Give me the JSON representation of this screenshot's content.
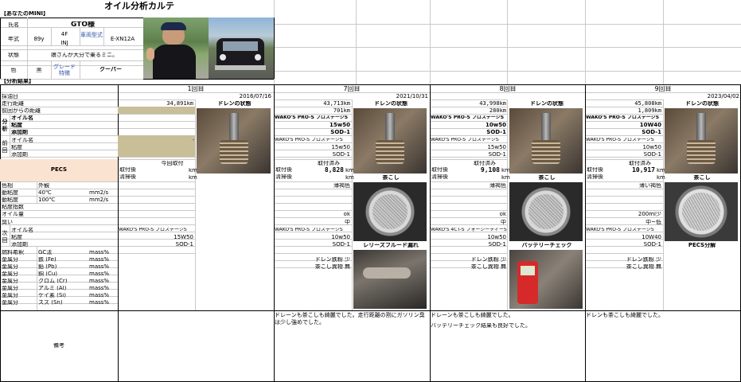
{
  "title": "オイル分析カルテ",
  "profile": {
    "section": "【あなたのMINI】",
    "name_label": "氏名",
    "name_value": "GTO様",
    "year_label": "年式",
    "year_value": "89y",
    "engine_top": "4F",
    "engine_bottom": "INJ",
    "vehicle_type_label": "車両型式",
    "vehicle_type_value": "E-XN12A",
    "condition_label": "状態",
    "condition_value": "娘さんが大分で乗るミニ。",
    "color_label": "色",
    "color_value": "黒",
    "grade_label": "グレード特徴",
    "grade_value": "クーパー"
  },
  "results_section": "【分析結果】",
  "rows": {
    "date": "採油日",
    "mileage": "走行距離",
    "since_change": "前回からの距離",
    "oil_name": "オイル名",
    "viscosity": "粘度",
    "additive": "添加剤",
    "side_bunseki": "分析",
    "side_zenkai": "前回",
    "side_jikai": "次回",
    "pecs": "PECS",
    "color_appearance_a": "色相",
    "color_appearance_b": "外観",
    "kin40_a": "動粘度",
    "kin40_b": "40℃",
    "kin40_unit": "mm2/s",
    "kin100_a": "動粘度",
    "kin100_b": "100℃",
    "kin100_unit": "mm2/s",
    "vi": "粘度指数",
    "oil_amount": "オイル量",
    "smell": "臭い",
    "fuel_dilution_a": "燃料希釈",
    "fuel_dilution_b": "GC法",
    "unit": "mass%",
    "metals": [
      {
        "a": "金属分",
        "b": "鉄 (Fe)"
      },
      {
        "a": "金属分",
        "b": "鉛 (Pb)"
      },
      {
        "a": "金属分",
        "b": "銅 (Cu)"
      },
      {
        "a": "金属分",
        "b": "クロム (Cr)"
      },
      {
        "a": "金属分",
        "b": "アルミ (Al)"
      },
      {
        "a": "金属分",
        "b": "ケイ素 (Si)"
      },
      {
        "a": "金属分",
        "b": "スズ (Sn)"
      }
    ],
    "remarks": "備考"
  },
  "visits": [
    {
      "header": "1回目",
      "date": "2016/07/16",
      "mileage": "34,891km",
      "since": "",
      "oil": "",
      "visc": "",
      "add": "",
      "prev_oil": "-",
      "prev_visc": "",
      "prev_add": "",
      "pecs_title": "今回取付",
      "pecs_install": "取付後",
      "pecs_clean": "清掃後",
      "pecs_install_value": "",
      "pecs_km": "km",
      "color": "",
      "smell": "",
      "next_oil": "WAKO'S PRO-S プロステージS",
      "next_visc": "15W50",
      "next_add": "SOD-1",
      "drain_title": "ドレンの状態",
      "photo2_title": "",
      "crud1": "",
      "crud2": "",
      "remark": ""
    },
    {
      "header": "7回目",
      "date": "2021/10/31",
      "mileage": "43,713km",
      "since": "701km",
      "oil": "WAKO'S PRO-S プロステージS",
      "visc": "15w50",
      "add": "SOD-1",
      "prev_oil": "WAKO'S PRO-S プロステージS",
      "prev_visc": "15w50",
      "prev_add": "SOD-1",
      "pecs_title": "取付済み",
      "pecs_install": "取付後",
      "pecs_clean": "清掃後",
      "pecs_install_value": "8,828",
      "pecs_km": "km",
      "color": "薄褐色",
      "amount": "ok",
      "smell": "中",
      "next_oil": "WAKO'S PRO-S プロステージS",
      "next_visc": "10w50",
      "next_add": "SOD-1",
      "drain_title": "ドレンの状態",
      "strainer_title": "茶こし",
      "photo2_title": "レリーズフルード漏れ",
      "crud1": "ドレン鉄粉 少",
      "crud2": "茶こし異物 無",
      "remark": "ドレーンも茶こしも綺麗でした。走行距離の割にガソリン臭は少し強めでした。"
    },
    {
      "header": "8回目",
      "date": "",
      "mileage": "43,998km",
      "since": "280km",
      "oil": "WAKO'S PRO-S プロステージS",
      "visc": "10w50",
      "add": "SOD-1",
      "prev_oil": "WAKO'S PRO-S プロステージS",
      "prev_visc": "15w50",
      "prev_add": "SOD-1",
      "pecs_title": "取付済み",
      "pecs_install": "取付後",
      "pecs_clean": "清掃後",
      "pecs_install_value": "9,108",
      "pecs_km": "km",
      "color": "薄褐色",
      "amount": "ok",
      "smell": "中",
      "next_oil": "WAKO'S 4CT-S フォーシーティーS",
      "next_visc": "10w50",
      "next_add": "SOD-1",
      "drain_title": "ドレンの状態",
      "strainer_title": "茶こし",
      "photo2_title": "バッテリーチェック",
      "crud1": "ドレン鉄粉 少",
      "crud2": "茶こし異物 無",
      "remark": "ドレーンも茶こしも綺麗でした。",
      "remark2": "バッテリーチェック結果も良好でした。"
    },
    {
      "header": "9回目",
      "date": "2023/04/02",
      "mileage": "45,808km",
      "since": "1,809km",
      "oil": "WAKO'S PRO-S プロステージS",
      "visc": "10W40",
      "add": "SOD-1",
      "prev_oil": "WAKO'S PRO-S プロステージS",
      "prev_visc": "10w50",
      "prev_add": "SOD-1",
      "pecs_title": "取付済み",
      "pecs_install": "取付後",
      "pecs_clean": "清掃後",
      "pecs_install_value": "10,917",
      "pecs_km": "km",
      "color": "薄い褐色",
      "amount": "200ml少",
      "smell": "中~低",
      "next_oil": "WAKO'S PRO-S プロステージS",
      "next_visc": "10W40",
      "next_add": "SOD-1",
      "drain_title": "ドレンの状態",
      "strainer_title": "茶こし",
      "photo2_title": "PECS分解",
      "crud1": "ドレン鉄粉 少",
      "crud2": "茶こし異物 無",
      "remark": "ドレンも茶こしも綺麗でした。"
    }
  ],
  "colors": {
    "shade": "#c8bf98",
    "pink": "#fbe3d2",
    "grid": "#c9c9c9"
  }
}
